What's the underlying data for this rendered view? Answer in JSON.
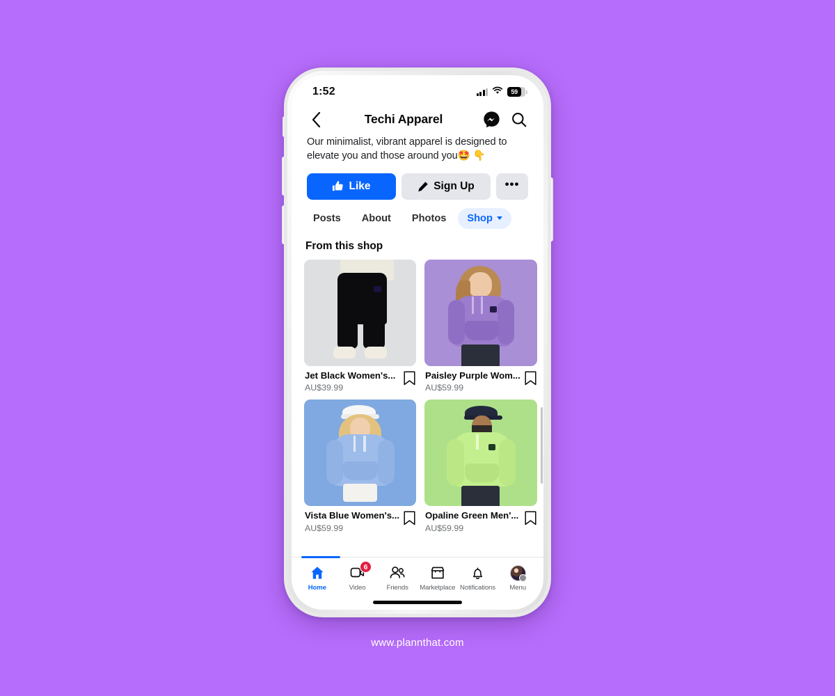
{
  "status_bar": {
    "time": "1:52",
    "battery_level": "59",
    "signal_icon": "cellular-signal-icon",
    "wifi_icon": "wifi-icon",
    "battery_icon": "battery-icon"
  },
  "header": {
    "back_icon": "back-chevron-icon",
    "title": "Techi Apparel",
    "messenger_icon": "messenger-icon",
    "search_icon": "search-icon"
  },
  "bio": {
    "line1": "Our minimalist, vibrant apparel is designed to",
    "line2": "elevate you and those around you",
    "emoji1": "🤩",
    "emoji2": "👇"
  },
  "actions": {
    "like_label": "Like",
    "like_icon": "thumbs-up-icon",
    "like_color": "#0866ff",
    "signup_label": "Sign Up",
    "signup_icon": "pencil-icon",
    "more_label": "•••"
  },
  "tabs": [
    {
      "label": "Posts",
      "active": false
    },
    {
      "label": "About",
      "active": false
    },
    {
      "label": "Photos",
      "active": false
    },
    {
      "label": "Shop",
      "active": true,
      "icon": "chevron-down-icon"
    }
  ],
  "shop": {
    "heading": "From this shop",
    "save_icon": "bookmark-icon",
    "products": [
      {
        "title": "Jet Black Women's...",
        "price": "AU$39.99",
        "bg": "#dedfe1"
      },
      {
        "title": "Paisley Purple Wom...",
        "price": "AU$59.99",
        "bg": "#a98fd6"
      },
      {
        "title": "Vista Blue Women's...",
        "price": "AU$59.99",
        "bg": "#7fa9e0"
      },
      {
        "title": "Opaline Green Men'...",
        "price": "AU$59.99",
        "bg": "#aee08a"
      }
    ]
  },
  "bottom_nav": {
    "items": [
      {
        "label": "Home",
        "icon": "home-icon",
        "active": true
      },
      {
        "label": "Video",
        "icon": "video-icon",
        "active": false,
        "badge": "6"
      },
      {
        "label": "Friends",
        "icon": "friends-icon",
        "active": false
      },
      {
        "label": "Marketplace",
        "icon": "marketplace-icon",
        "active": false
      },
      {
        "label": "Notifications",
        "icon": "bell-icon",
        "active": false
      },
      {
        "label": "Menu",
        "icon": "avatar-menu-icon",
        "active": false
      }
    ]
  },
  "footer": {
    "url": "www.plannthat.com"
  },
  "theme": {
    "background": "#b76dfb",
    "accent": "#0866ff",
    "badge": "#e41e3f"
  }
}
